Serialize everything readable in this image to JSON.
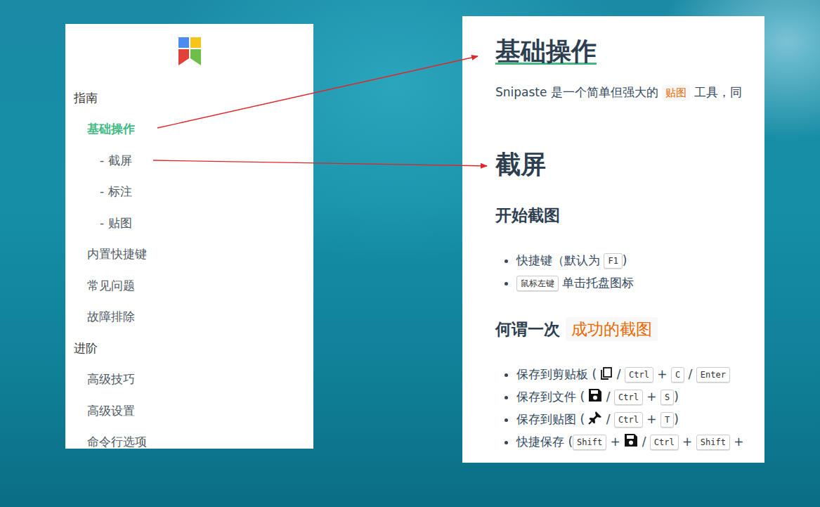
{
  "sidebar": {
    "items": [
      {
        "label": "指南",
        "kind": "section",
        "selected": false
      },
      {
        "label": "基础操作",
        "kind": "page",
        "selected": true
      },
      {
        "label": "- 截屏",
        "kind": "sub",
        "selected": false
      },
      {
        "label": "- 标注",
        "kind": "sub",
        "selected": false
      },
      {
        "label": "- 贴图",
        "kind": "sub",
        "selected": false
      },
      {
        "label": "内置快捷键",
        "kind": "page",
        "selected": false
      },
      {
        "label": "常见问题",
        "kind": "page",
        "selected": false
      },
      {
        "label": "故障排除",
        "kind": "page",
        "selected": false
      },
      {
        "label": "进阶",
        "kind": "section",
        "selected": false
      },
      {
        "label": "高级技巧",
        "kind": "page",
        "selected": false
      },
      {
        "label": "高级设置",
        "kind": "page",
        "selected": false
      },
      {
        "label": "命令行选项",
        "kind": "page",
        "selected": false
      }
    ]
  },
  "document": {
    "blocks": [
      {
        "kind": "h1",
        "segments": [
          {
            "kind": "anchor",
            "text": "基础操作"
          }
        ]
      },
      {
        "kind": "p",
        "segments": [
          {
            "kind": "text",
            "text": "Snipaste 是一个简单但强大的 "
          },
          {
            "kind": "code",
            "text": "贴图"
          },
          {
            "kind": "text",
            "text": " 工具，同"
          }
        ]
      },
      {
        "kind": "h1",
        "segments": [
          {
            "kind": "text",
            "text": "截屏"
          }
        ]
      },
      {
        "kind": "h2",
        "segments": [
          {
            "kind": "text",
            "text": "开始截图"
          }
        ]
      },
      {
        "kind": "list",
        "items": [
          [
            {
              "kind": "text",
              "text": "快捷键（默认为 "
            },
            {
              "kind": "kbd",
              "text": "F1"
            },
            {
              "kind": "text",
              "text": ")"
            }
          ],
          [
            {
              "kind": "kbd",
              "text": "鼠标左键"
            },
            {
              "kind": "text",
              "text": " 单击托盘图标"
            }
          ]
        ]
      },
      {
        "kind": "h2",
        "segments": [
          {
            "kind": "text",
            "text": "何谓一次 "
          },
          {
            "kind": "mark",
            "text": "成功的截图"
          }
        ]
      },
      {
        "kind": "list",
        "items": [
          [
            {
              "kind": "text",
              "text": "保存到剪贴板 ( "
            },
            {
              "kind": "copy",
              "text": ""
            },
            {
              "kind": "text",
              "text": " / "
            },
            {
              "kind": "kbd",
              "text": "Ctrl"
            },
            {
              "kind": "text",
              "text": " + "
            },
            {
              "kind": "kbd",
              "text": "C"
            },
            {
              "kind": "text",
              "text": " / "
            },
            {
              "kind": "kbd",
              "text": "Enter"
            }
          ],
          [
            {
              "kind": "text",
              "text": "保存到文件 ( "
            },
            {
              "kind": "save",
              "text": ""
            },
            {
              "kind": "text",
              "text": " / "
            },
            {
              "kind": "kbd",
              "text": "Ctrl"
            },
            {
              "kind": "text",
              "text": " + "
            },
            {
              "kind": "kbd",
              "text": "S"
            },
            {
              "kind": "text",
              "text": ")"
            }
          ],
          [
            {
              "kind": "text",
              "text": "保存到贴图 ( "
            },
            {
              "kind": "pin",
              "text": ""
            },
            {
              "kind": "text",
              "text": " / "
            },
            {
              "kind": "kbd",
              "text": "Ctrl"
            },
            {
              "kind": "text",
              "text": " + "
            },
            {
              "kind": "kbd",
              "text": "T"
            },
            {
              "kind": "text",
              "text": ")"
            }
          ],
          [
            {
              "kind": "text",
              "text": "快捷保存 ("
            },
            {
              "kind": "kbd",
              "text": "Shift"
            },
            {
              "kind": "text",
              "text": " + "
            },
            {
              "kind": "save",
              "text": ""
            },
            {
              "kind": "text",
              "text": " / "
            },
            {
              "kind": "kbd",
              "text": "Ctrl"
            },
            {
              "kind": "text",
              "text": " + "
            },
            {
              "kind": "kbd",
              "text": "Shift"
            },
            {
              "kind": "text",
              "text": " +"
            }
          ]
        ]
      }
    ]
  }
}
